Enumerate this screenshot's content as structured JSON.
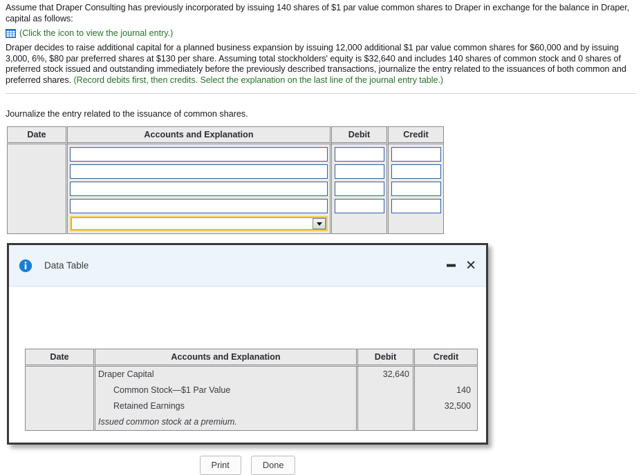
{
  "problem": {
    "paragraph1": "Assume that Draper Consulting has previously incorporated by issuing 140 shares of $1 par value common shares to Draper in exchange for the balance in Draper, capital as follows:",
    "link_icon": "table-grid-icon",
    "link_text": "(Click the icon to view the journal entry.)",
    "paragraph2_main": "Draper decides to raise additional capital for a planned business expansion by issuing 12,000 additional $1 par value common shares for $60,000 and by issuing 3,000, 6%, $80 par preferred shares at $130 per share. Assuming total stockholders' equity is $32,640 and includes 140 shares of common stock and 0 shares of preferred stock issued and outstanding immediately before the previously described transactions, journalize the entry related to the issuances of both common and preferred shares.",
    "paragraph2_instruction": "(Record debits first, then credits. Select the explanation on the last line of the journal entry table.)",
    "prompt": "Journalize the entry related to the issuance of common shares."
  },
  "answer_table": {
    "headers": {
      "date": "Date",
      "accounts": "Accounts and Explanation",
      "debit": "Debit",
      "credit": "Credit"
    },
    "rows": [
      {
        "accounts": "",
        "debit": "",
        "credit": ""
      },
      {
        "accounts": "",
        "debit": "",
        "credit": ""
      },
      {
        "accounts": "",
        "debit": "",
        "credit": ""
      },
      {
        "accounts": "",
        "debit": "",
        "credit": ""
      }
    ],
    "explanation_select": {
      "value": "",
      "caret": "chevron-down-icon"
    }
  },
  "dialog": {
    "icon": "info-circle-icon",
    "title": "Data Table",
    "minimize_label": "",
    "close_label": "✕",
    "table": {
      "headers": {
        "date": "Date",
        "accounts": "Accounts and Explanation",
        "debit": "Debit",
        "credit": "Credit"
      },
      "rows": [
        {
          "date": "",
          "accounts": "Draper Capital",
          "indent": false,
          "italic": false,
          "debit": "32,640",
          "credit": ""
        },
        {
          "date": "",
          "accounts": "Common Stock—$1 Par Value",
          "indent": true,
          "italic": false,
          "debit": "",
          "credit": "140"
        },
        {
          "date": "",
          "accounts": "Retained Earnings",
          "indent": true,
          "italic": false,
          "debit": "",
          "credit": "32,500"
        },
        {
          "date": "",
          "accounts": "Issued common stock at a premium.",
          "indent": false,
          "italic": true,
          "debit": "",
          "credit": ""
        }
      ]
    },
    "buttons": {
      "print": "Print",
      "done": "Done"
    }
  },
  "colors": {
    "instruction_green": "#267326",
    "field_border_blue": "#2c5fac",
    "select_highlight_yellow": "#f5cf5a",
    "dialog_header_blue": "#eef4fc",
    "info_icon_blue": "#1a7fd4",
    "table_background": "#eaeaea"
  }
}
